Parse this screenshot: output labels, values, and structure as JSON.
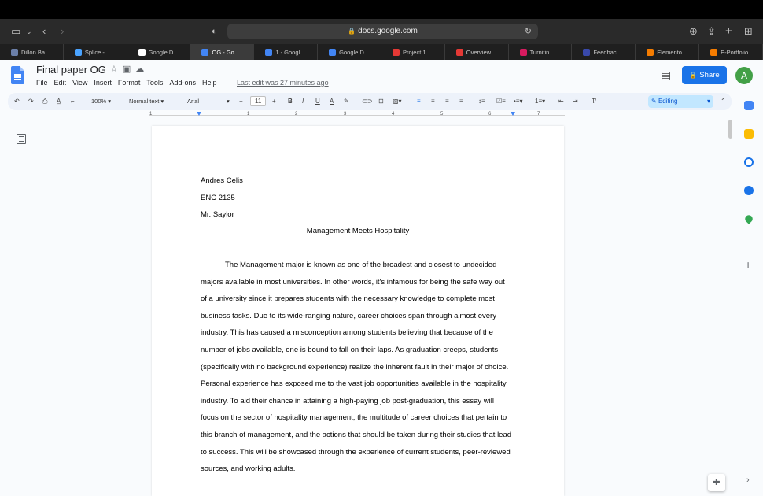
{
  "browser": {
    "url": "docs.google.com",
    "tabs": [
      {
        "label": "Dillon Ba...",
        "color": "#6b7fa8"
      },
      {
        "label": "Splice -...",
        "color": "#4aa3ff"
      },
      {
        "label": "Google D...",
        "color": "#ffffff"
      },
      {
        "label": "OG - Go...",
        "color": "#4285f4",
        "active": true
      },
      {
        "label": "1 - Googl...",
        "color": "#4285f4"
      },
      {
        "label": "Google D...",
        "color": "#4285f4"
      },
      {
        "label": "Project 1...",
        "color": "#e53935"
      },
      {
        "label": "Overview...",
        "color": "#e53935"
      },
      {
        "label": "Turnitin...",
        "color": "#d81b60"
      },
      {
        "label": "Feedbac...",
        "color": "#3949ab"
      },
      {
        "label": "Elemento...",
        "color": "#f57c00"
      },
      {
        "label": "E-Portfolio",
        "color": "#f57c00"
      }
    ]
  },
  "doc": {
    "title": "Final paper OG",
    "menu": [
      "File",
      "Edit",
      "View",
      "Insert",
      "Format",
      "Tools",
      "Add-ons",
      "Help"
    ],
    "last_edit": "Last edit was 27 minutes ago",
    "share_label": "Share",
    "avatar_letter": "A"
  },
  "toolbar": {
    "zoom": "100%",
    "style": "Normal text",
    "font": "Arial",
    "font_size": "11",
    "mode": "Editing"
  },
  "ruler": [
    "1",
    "1",
    "2",
    "3",
    "4",
    "5",
    "6",
    "7"
  ],
  "content": {
    "header_lines": [
      "Andres Celis",
      "ENC 2135",
      "Mr. Saylor"
    ],
    "essay_title": "Management Meets Hospitality",
    "body_lines": [
      "The Management major is known as one of the broadest and closest to undecided",
      "majors available in most universities. In other words, it's infamous for being the safe way out",
      "of a university since it prepares students with the necessary knowledge to complete most",
      "business tasks. Due to its wide-ranging nature, career choices span through almost every",
      "industry. This has caused a misconception among students believing that because of the",
      "number of jobs available, one is bound to fall on their laps. As graduation creeps, students",
      "(specifically with no background experience) realize the inherent fault in their major of choice.",
      "Personal experience has exposed me to the vast job opportunities available in the hospitality",
      "industry. To aid their chance in attaining a high-paying job post-graduation, this essay will",
      "focus on the sector of hospitality management, the multitude of career choices that pertain to",
      "this branch of management, and the actions that should be taken during their studies that lead",
      "to success. This will be showcased through the experience of current students, peer-reviewed",
      "sources, and working adults."
    ]
  },
  "colors": {
    "accent": "#1a73e8",
    "avatar": "#43a047"
  }
}
